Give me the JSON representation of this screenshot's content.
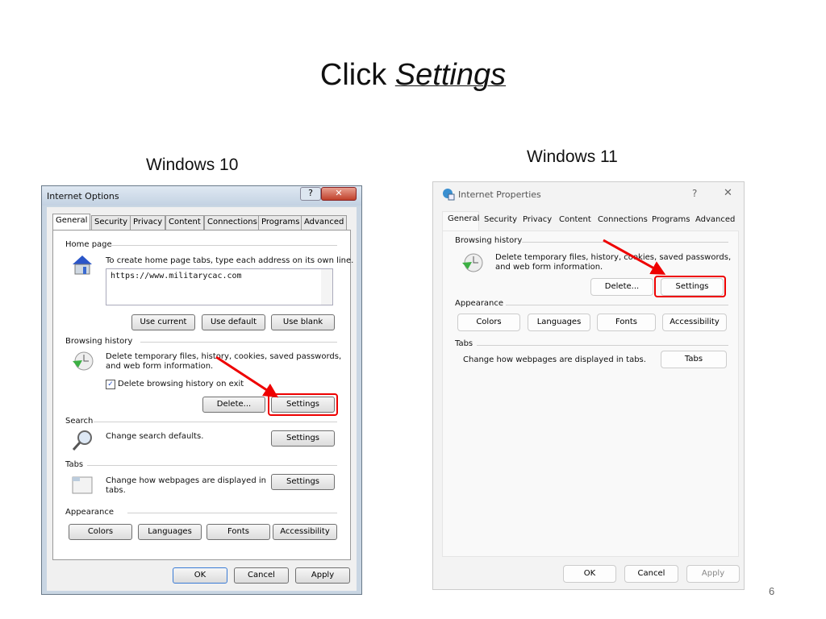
{
  "slide": {
    "title_prefix": "Click ",
    "title_emph": "Settings",
    "left_caption": "Windows 10",
    "right_caption": "Windows 11",
    "page_number": "6"
  },
  "win10": {
    "title": "Internet Options",
    "help": "?",
    "close": "✕",
    "tabs": [
      "General",
      "Security",
      "Privacy",
      "Content",
      "Connections",
      "Programs",
      "Advanced"
    ],
    "home_page": {
      "label": "Home page",
      "desc": "To create home page tabs, type each address on its own line.",
      "url": "https://www.militarycac.com",
      "buttons": [
        "Use current",
        "Use default",
        "Use blank"
      ]
    },
    "browsing": {
      "label": "Browsing history",
      "desc1": "Delete temporary files, history, cookies, saved passwords,",
      "desc2": "and web form information.",
      "checkbox": "Delete browsing history on exit",
      "checked": true,
      "delete": "Delete...",
      "settings": "Settings"
    },
    "search": {
      "label": "Search",
      "desc": "Change search defaults.",
      "settings": "Settings"
    },
    "tabs_group": {
      "label": "Tabs",
      "desc1": "Change how webpages are displayed in",
      "desc2": "tabs.",
      "settings": "Settings"
    },
    "appearance": {
      "label": "Appearance",
      "buttons": [
        "Colors",
        "Languages",
        "Fonts",
        "Accessibility"
      ]
    },
    "footer": [
      "OK",
      "Cancel",
      "Apply"
    ]
  },
  "win11": {
    "title": "Internet Properties",
    "help": "?",
    "close": "✕",
    "tabs": [
      "General",
      "Security",
      "Privacy",
      "Content",
      "Connections",
      "Programs",
      "Advanced"
    ],
    "browsing": {
      "label": "Browsing history",
      "desc1": "Delete temporary files, history, cookies, saved passwords,",
      "desc2": "and web form information.",
      "delete": "Delete...",
      "settings": "Settings"
    },
    "appearance": {
      "label": "Appearance",
      "buttons": [
        "Colors",
        "Languages",
        "Fonts",
        "Accessibility"
      ]
    },
    "tabs_group": {
      "label": "Tabs",
      "desc": "Change how webpages are displayed in tabs.",
      "button": "Tabs"
    },
    "footer": [
      "OK",
      "Cancel",
      "Apply"
    ]
  },
  "colors": {
    "highlight": "#e00000"
  }
}
